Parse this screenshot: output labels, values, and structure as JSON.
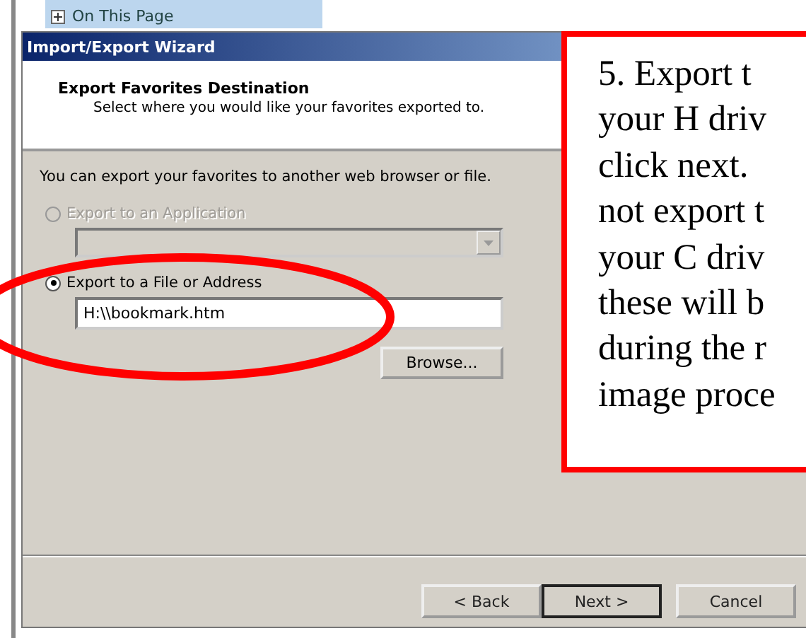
{
  "background_page": {
    "section_link": "On This Page"
  },
  "window": {
    "title": "Import/Export Wizard"
  },
  "header": {
    "title": "Export Favorites Destination",
    "subtitle": "Select where you would like your favorites exported to."
  },
  "intro": "You can export your favorites to another web browser or file.",
  "options": [
    {
      "kind": "dropdown",
      "label": "Export to an Application",
      "selected": false,
      "disabled": true
    },
    {
      "kind": "text",
      "label": "Export to a File or Address",
      "selected": true,
      "disabled": false,
      "value": "H:\\\\bookmark.htm",
      "button": "Browse..."
    }
  ],
  "buttons": [
    {
      "label": "< Back",
      "default": false
    },
    {
      "label": "Next >",
      "default": true
    },
    {
      "label": "Cancel",
      "default": false
    }
  ],
  "callout": {
    "lines": [
      "5.  Export t",
      "your H driv",
      "click next.",
      "not export t",
      "your C driv",
      "these will b",
      "during the r",
      "image proce"
    ]
  }
}
